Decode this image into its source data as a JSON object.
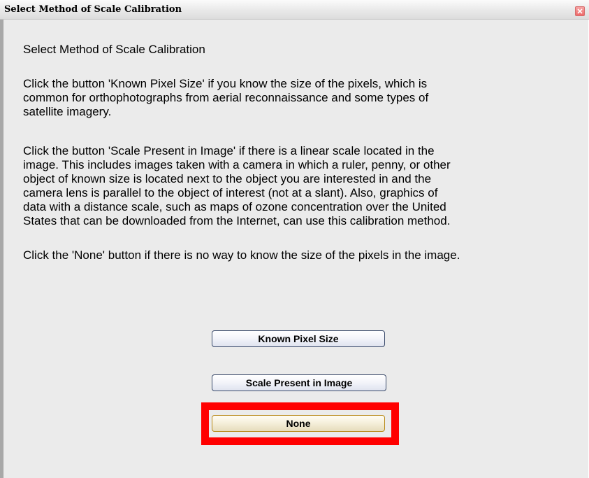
{
  "window": {
    "title": "Select Method of Scale Calibration",
    "close_icon": "close-icon"
  },
  "content": {
    "heading": "Select Method of Scale Calibration",
    "paragraph1": "Click the button 'Known Pixel Size' if you know the size of the pixels, which is\ncommon for orthophotographs from aerial reconnaissance and some types of\nsatellite imagery.",
    "paragraph2": "Click the button 'Scale Present in Image' if there is a linear scale located in the\nimage.  This includes images taken with a camera in which a ruler, penny, or other\nobject of known size is located next to the object you are interested in and the\ncamera lens is parallel to the object of interest (not at a slant).  Also, graphics of\ndata with a distance scale, such as maps of ozone concentration over the United\nStates that can be downloaded from the Internet, can use this calibration method.",
    "paragraph3": "Click the 'None' button if there is no way to know the size of the pixels in the image."
  },
  "buttons": {
    "known_pixel_size": "Known Pixel Size",
    "scale_present": "Scale Present in Image",
    "none": "None"
  },
  "colors": {
    "highlight": "#ff0000",
    "background": "#ebebeb",
    "close_button": "#ee6a6a"
  }
}
